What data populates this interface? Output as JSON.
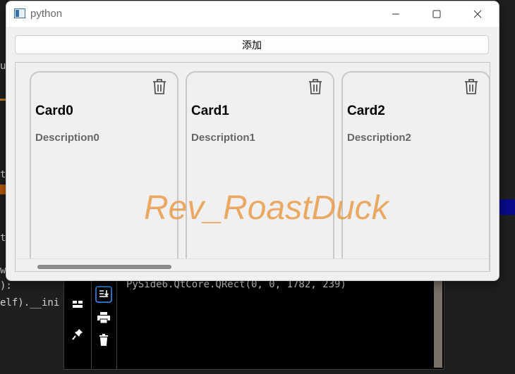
{
  "window": {
    "title": "python",
    "add_button_label": "添加",
    "minimize_glyph": "—",
    "maximize_glyph": "☐",
    "close_glyph": "✕"
  },
  "cards": [
    {
      "title": "Card0",
      "description": "Description0",
      "delete_icon": "trash-icon"
    },
    {
      "title": "Card1",
      "description": "Description1",
      "delete_icon": "trash-icon"
    },
    {
      "title": "Card2",
      "description": "Description2",
      "delete_icon": "trash-icon"
    }
  ],
  "watermark": "Rev_RoastDuck",
  "background": {
    "code_fragments": [
      "u",
      "t",
      "t",
      "w",
      "):",
      "elf).__ini"
    ],
    "terminal_output": "PySide6.QtCore.QRect(0, 0, 1782, 239)"
  },
  "colors": {
    "watermark": "#e89a45",
    "window_bg": "#f0f0f0",
    "card_border": "#c8c8c8"
  }
}
